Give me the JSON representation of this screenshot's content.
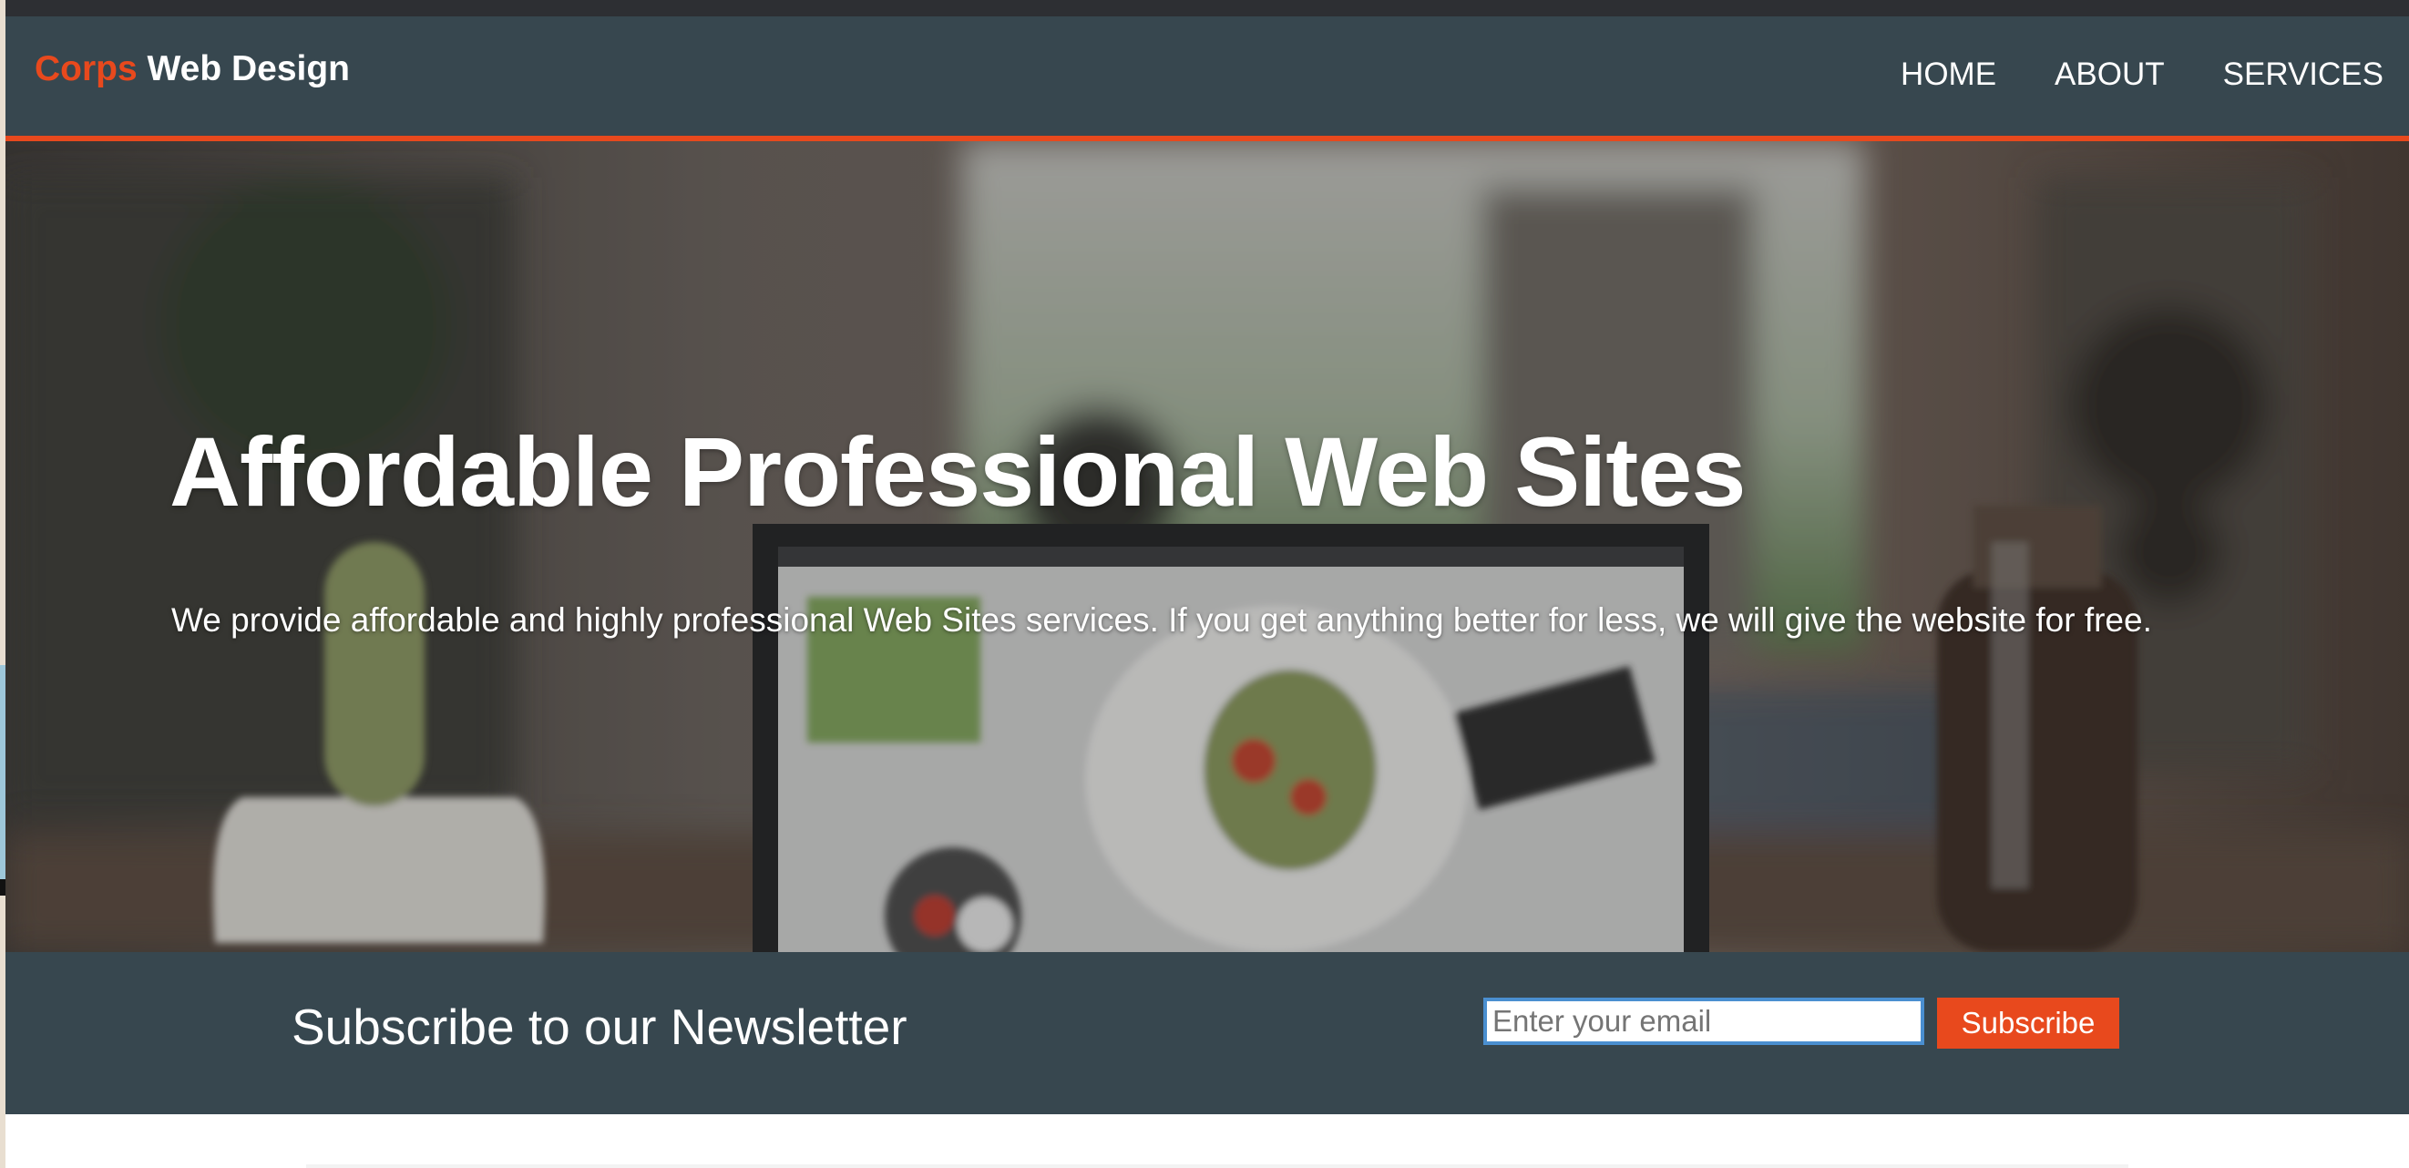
{
  "header": {
    "logo_highlight": "Corps",
    "logo_rest": " Web Design",
    "accent_color": "#e8491d",
    "bar_color": "#37474f",
    "nav": [
      {
        "label": "HOME"
      },
      {
        "label": "ABOUT"
      },
      {
        "label": "SERVICES"
      }
    ]
  },
  "hero": {
    "title": "Affordable Professional Web Sites",
    "text": "We provide affordable and highly professional Web Sites services. If you get anything better for less, we will give the website for free."
  },
  "newsletter": {
    "heading": "Subscribe to our Newsletter",
    "email_placeholder": "Enter your email",
    "email_value": "",
    "button_label": "Subscribe"
  }
}
